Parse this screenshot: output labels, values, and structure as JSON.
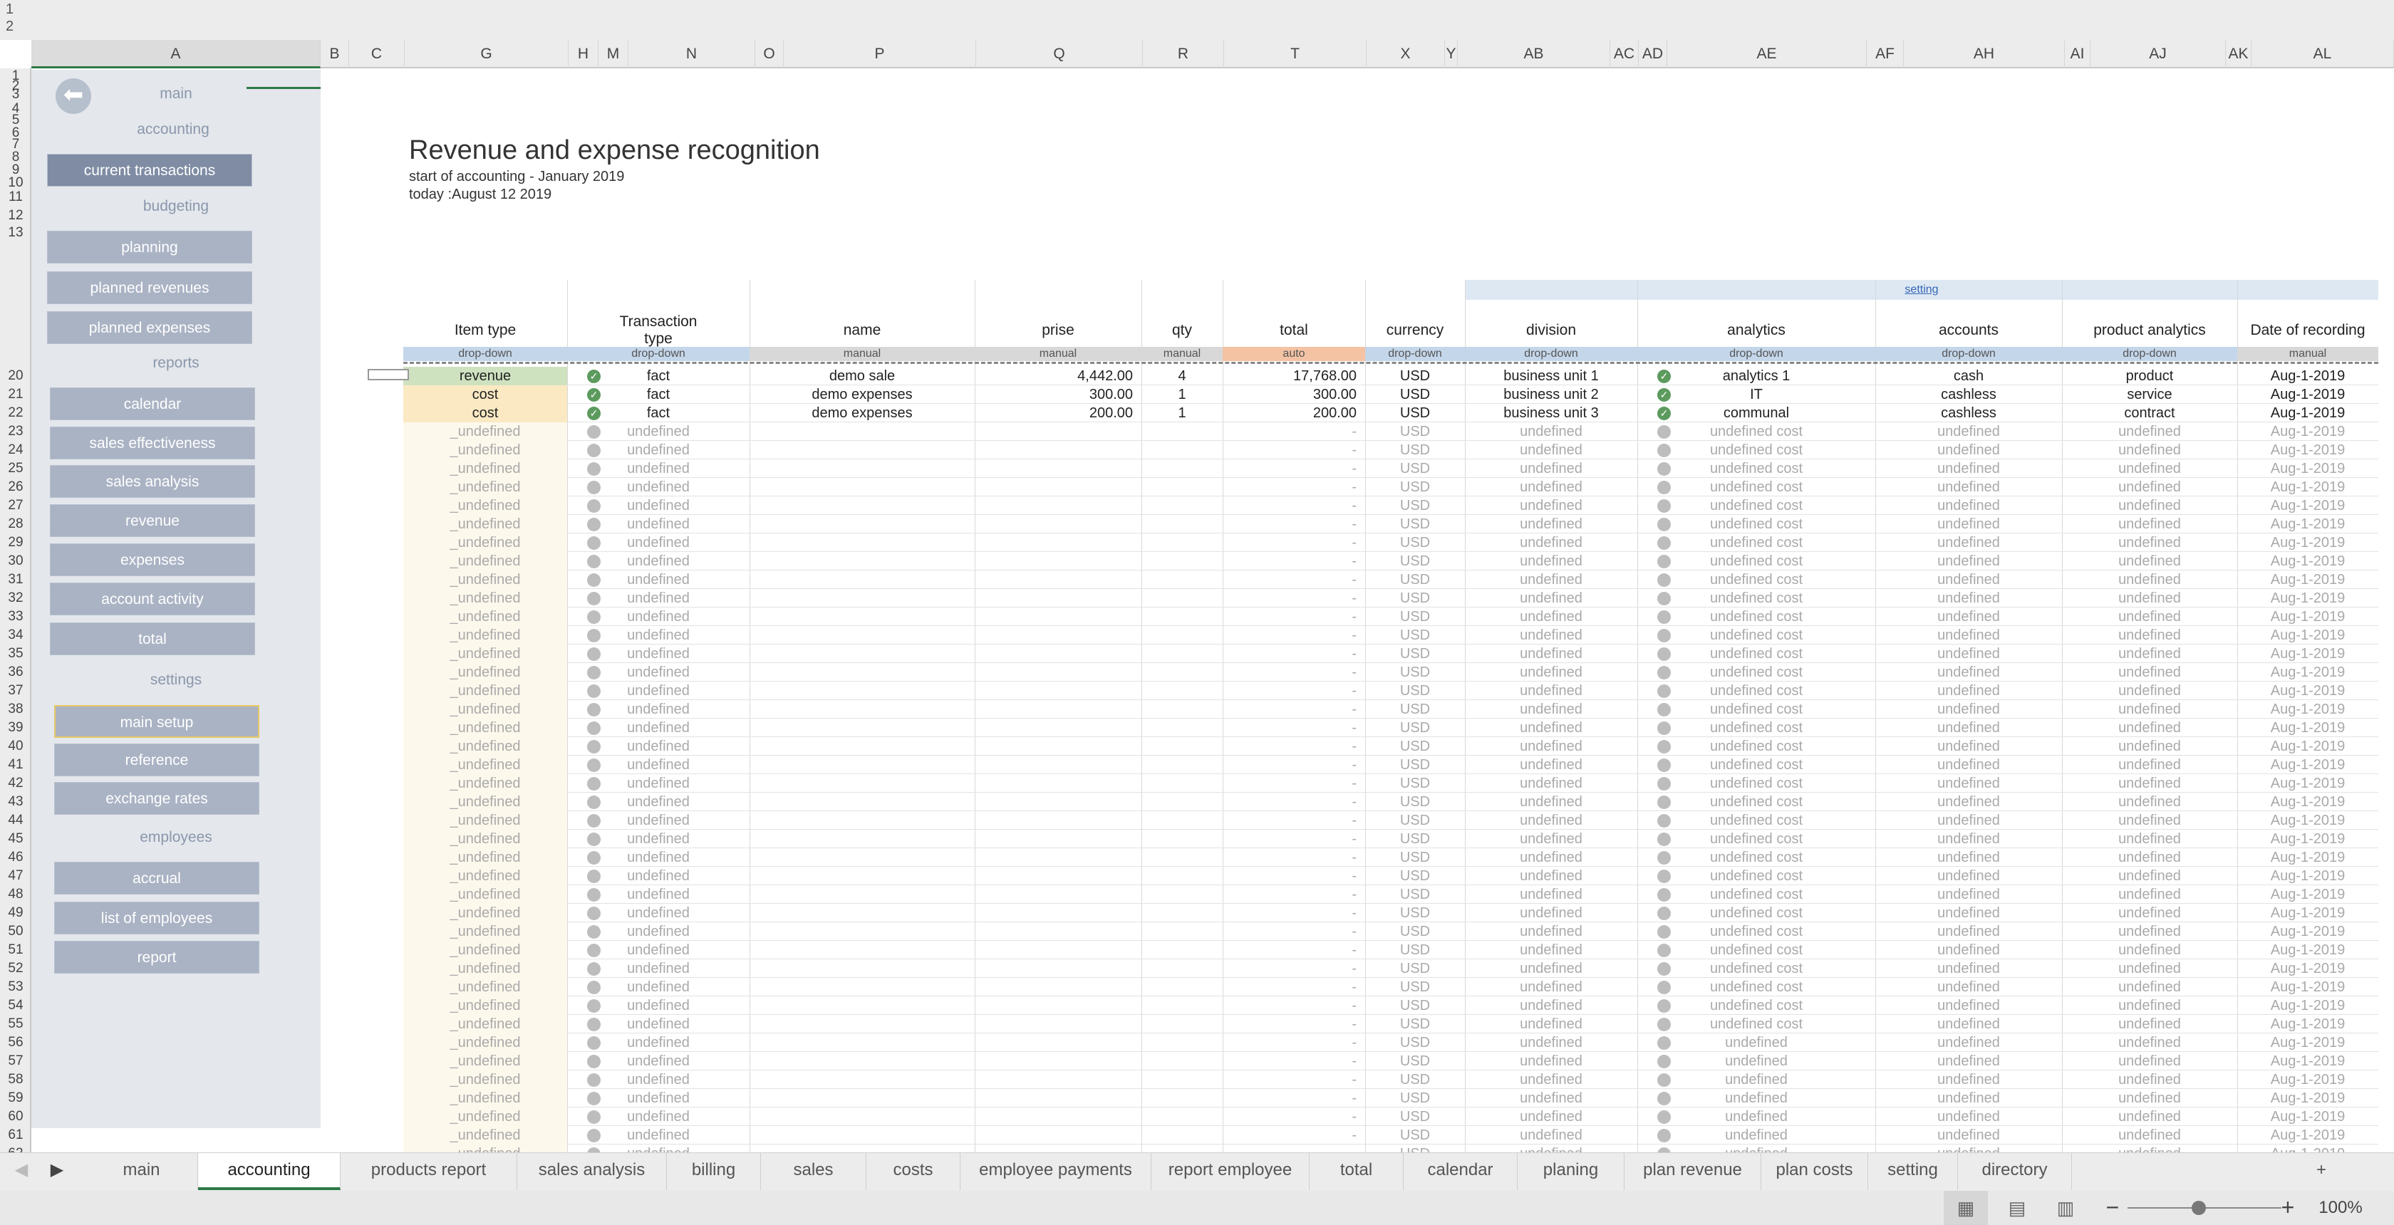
{
  "outline_levels": [
    "1",
    "2"
  ],
  "columns": [
    "A",
    "B",
    "C",
    "G",
    "H",
    "M",
    "N",
    "O",
    "P",
    "Q",
    "R",
    "T",
    "X",
    "Y",
    "AB",
    "AC",
    "AD",
    "AE",
    "AF",
    "AH",
    "AI",
    "AJ",
    "AK",
    "AL"
  ],
  "rows": [
    "1",
    "2",
    "3",
    "4",
    "5",
    "6",
    "7",
    "8",
    "9",
    "10",
    "11",
    "12",
    "13",
    "20",
    "21",
    "22",
    "23",
    "24",
    "25",
    "26",
    "27",
    "28",
    "29",
    "30",
    "31",
    "32",
    "33",
    "34",
    "35",
    "36",
    "37",
    "38",
    "39",
    "40",
    "41",
    "42",
    "43",
    "44",
    "45",
    "46",
    "47",
    "48",
    "49",
    "50",
    "51",
    "52",
    "53",
    "54",
    "55",
    "56",
    "57",
    "58",
    "59",
    "60",
    "61",
    "62"
  ],
  "sidebar": {
    "back": "⬅",
    "main": "main",
    "accounting": "accounting",
    "current_transactions": "current transactions",
    "budgeting": "budgeting",
    "planning": "planning",
    "planned_revenues": "planned revenues",
    "planned_expenses": "planned expenses",
    "reports": "reports",
    "calendar": "calendar",
    "sales_effectiveness": "sales effectiveness",
    "sales_analysis": "sales analysis",
    "revenue": "revenue",
    "expenses": "expenses",
    "account_activity": "account activity",
    "total": "total",
    "settings": "settings",
    "main_setup": "main setup",
    "reference": "reference",
    "exchange_rates": "exchange rates",
    "employees": "employees",
    "accrual": "accrual",
    "list_of_employees": "list of employees",
    "report": "report"
  },
  "title": "Revenue and expense recognition",
  "start_of_accounting": "start of accounting - January 2019",
  "today": "today :August 12 2019",
  "setting_link": "setting",
  "headers": {
    "item_type": "Item type",
    "transaction_type": "Transaction type",
    "name": "name",
    "prise": "prise",
    "qty": "qty",
    "total": "total",
    "currency": "currency",
    "division": "division",
    "analytics": "analytics",
    "accounts": "accounts",
    "product_analytics": "product analytics",
    "date_of_recording": "Date of recording"
  },
  "input_types": {
    "item_type": "drop-down",
    "transaction_type": "drop-down",
    "name": "manual",
    "prise": "manual",
    "qty": "manual",
    "total": "auto",
    "currency": "drop-down",
    "division": "drop-down",
    "analytics": "drop-down",
    "accounts": "drop-down",
    "product_analytics": "drop-down",
    "date_of_recording": "manual"
  },
  "transactions": [
    {
      "item_type": "revenue",
      "transaction_type": "fact",
      "name": "demo sale",
      "prise": "4,442.00",
      "qty": "4",
      "total": "17,768.00",
      "currency": "USD",
      "division": "business unit 1",
      "analytics": "analytics 1",
      "accounts": "cash",
      "product_analytics": "product",
      "date": "Aug-1-2019"
    },
    {
      "item_type": "cost",
      "transaction_type": "fact",
      "name": "demo expenses",
      "prise": "300.00",
      "qty": "1",
      "total": "300.00",
      "currency": "USD",
      "division": "business unit 2",
      "analytics": "IT",
      "accounts": "cashless",
      "product_analytics": "service",
      "date": "Aug-1-2019"
    },
    {
      "item_type": "cost",
      "transaction_type": "fact",
      "name": "demo expenses",
      "prise": "200.00",
      "qty": "1",
      "total": "200.00",
      "currency": "USD",
      "division": "business unit 3",
      "analytics": "communal",
      "accounts": "cashless",
      "product_analytics": "contract",
      "date": "Aug-1-2019"
    }
  ],
  "placeholder": {
    "item_type": "_undefined",
    "transaction_type": "undefined",
    "total": "-",
    "currency": "USD",
    "division": "undefined",
    "analytics_cost": "undefined cost",
    "analytics": "undefined",
    "accounts": "undefined",
    "product_analytics": "undefined",
    "date": "Aug-1-2019"
  },
  "empty_rows_cost_count": 33,
  "empty_rows_plain_count": 7,
  "sheet_tabs": [
    "main",
    "accounting",
    "products report",
    "sales analysis",
    "billing",
    "sales",
    "costs",
    "employee payments",
    "report employee",
    "total",
    "calendar",
    "planing",
    "plan revenue",
    "plan costs",
    "setting",
    "directory"
  ],
  "active_tab": "accounting",
  "add_sheet": "+",
  "zoom": "100%",
  "colors": {
    "accent_green": "#2d7a47",
    "revenue_fill": "#cfe2c0",
    "cost_fill": "#fbe9c3",
    "dropdown_tag": "#c4d6ea",
    "auto_tag": "#f4c3a4",
    "sidebar_button": "#aab3c4"
  }
}
